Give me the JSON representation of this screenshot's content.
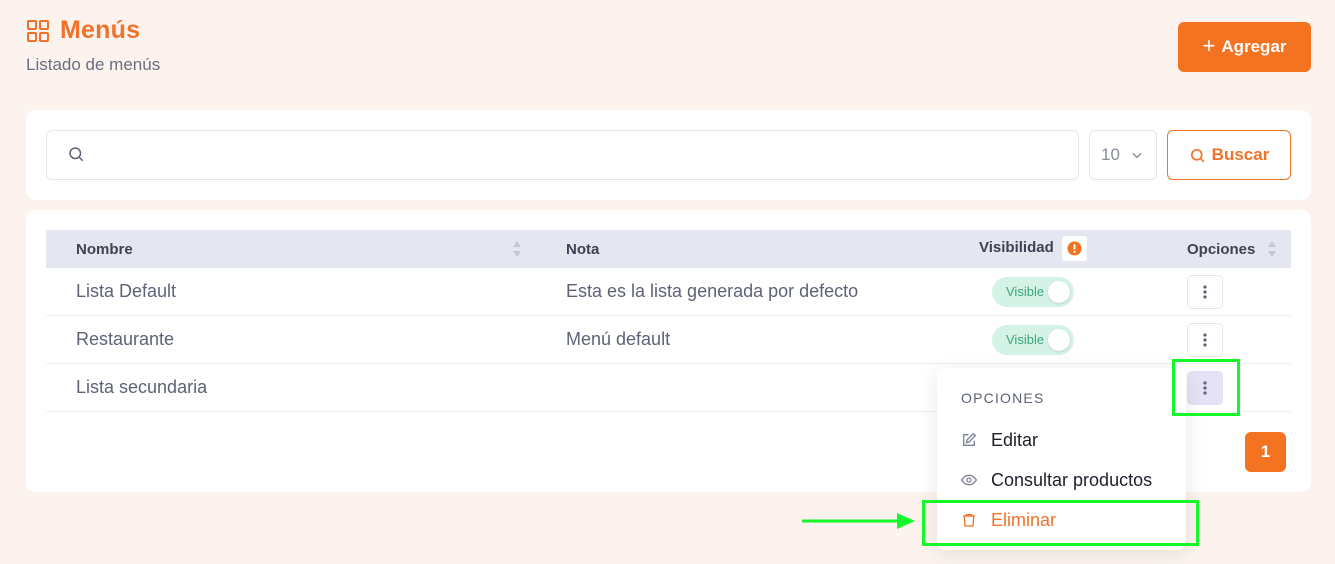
{
  "header": {
    "title": "Menús",
    "subtitle": "Listado de menús",
    "add_label": "Agregar"
  },
  "search": {
    "placeholder": "",
    "value": "",
    "page_size": "10",
    "button_label": "Buscar"
  },
  "table": {
    "columns": [
      "Nombre",
      "Nota",
      "Visibilidad",
      "Opciones"
    ],
    "rows": [
      {
        "name": "Lista Default",
        "note": "Esta es la lista generada por defecto",
        "visibility": "Visible"
      },
      {
        "name": "Restaurante",
        "note": "Menú default",
        "visibility": "Visible"
      },
      {
        "name": "Lista secundaria",
        "note": "",
        "visibility": ""
      }
    ]
  },
  "pagination": {
    "current": "1"
  },
  "dropdown": {
    "heading": "OPCIONES",
    "items": [
      {
        "label": "Editar",
        "icon": "edit-icon"
      },
      {
        "label": "Consultar productos",
        "icon": "eye-icon"
      },
      {
        "label": "Eliminar",
        "icon": "trash-icon"
      }
    ]
  },
  "colors": {
    "accent": "#f37321",
    "highlight": "#16f72a",
    "visible_bg": "#d4f2e6",
    "visible_text": "#3aa57a"
  }
}
